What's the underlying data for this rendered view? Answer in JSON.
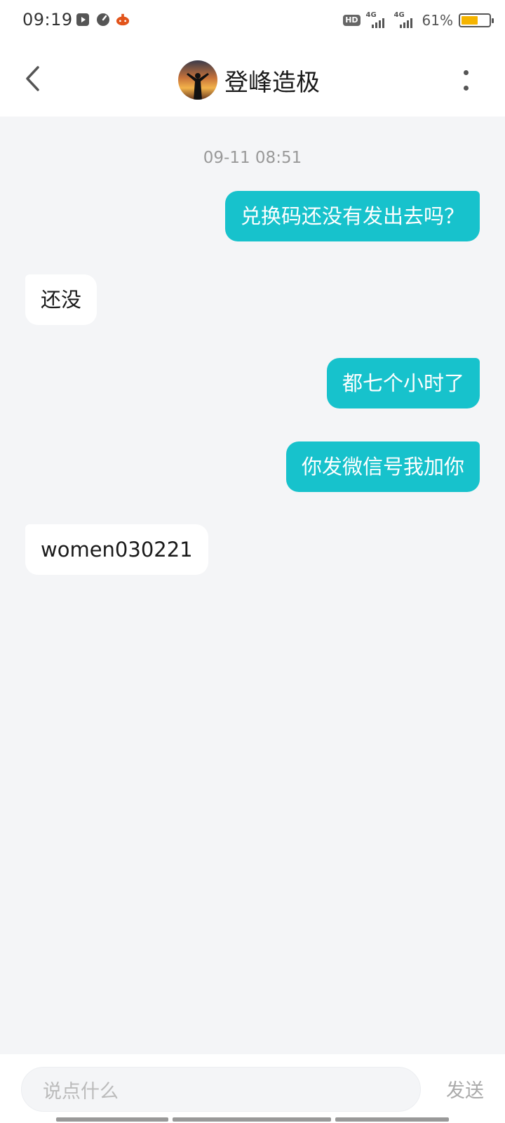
{
  "status_bar": {
    "time": "09:19",
    "hd_label": "HD",
    "net1_label": "4G",
    "net2_label": "4G",
    "battery_pct": "61%",
    "battery_level": 0.61,
    "battery_color": "#f5b400"
  },
  "header": {
    "title": "登峰造极",
    "back_icon": "chevron-left-icon",
    "more_icon": "more-vertical-icon"
  },
  "chat": {
    "timestamp": "09-11 08:51",
    "messages": [
      {
        "direction": "out",
        "text": "兑换码还没有发出去吗？"
      },
      {
        "direction": "in",
        "text": "还没"
      },
      {
        "direction": "out",
        "text": "都七个小时了"
      },
      {
        "direction": "out",
        "text": "你发微信号我加你"
      },
      {
        "direction": "in",
        "text": "women030221"
      }
    ]
  },
  "input_bar": {
    "placeholder": "说点什么",
    "send_label": "发送"
  },
  "colors": {
    "outgoing_bubble": "#17c2cc",
    "chat_background": "#f4f5f7"
  }
}
